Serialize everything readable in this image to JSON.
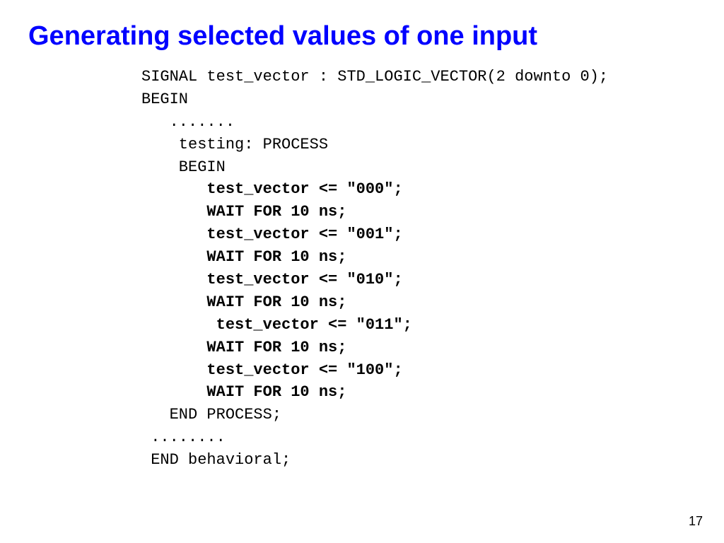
{
  "title": "Generating selected values of one input",
  "code": {
    "line1": "SIGNAL test_vector : STD_LOGIC_VECTOR(2 downto 0);",
    "line2": "",
    "line3": "BEGIN",
    "line4": "   .......",
    "line5": "    testing: PROCESS",
    "line6": "    BEGIN",
    "line7": "       test_vector <= \"000\";",
    "line8": "       WAIT FOR 10 ns;",
    "line9": "       test_vector <= \"001\";",
    "line10": "       WAIT FOR 10 ns;",
    "line11": "       test_vector <= \"010\";",
    "line12": "       WAIT FOR 10 ns;",
    "line13": "        test_vector <= \"011\";",
    "line14": "       WAIT FOR 10 ns;",
    "line15": "       test_vector <= \"100\";",
    "line16": "       WAIT FOR 10 ns;",
    "line17": "   END PROCESS;",
    "line18": " ........",
    "line19": " END behavioral;"
  },
  "page_number": "17"
}
